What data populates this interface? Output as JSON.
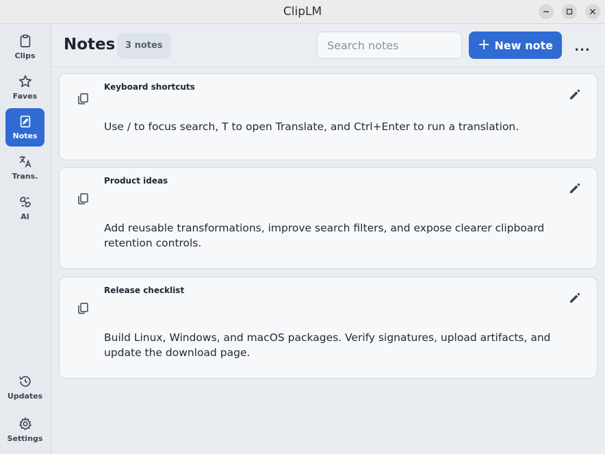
{
  "window": {
    "title": "ClipLM"
  },
  "sidebar": {
    "items": [
      {
        "label": "Clips",
        "icon": "clipboard-icon"
      },
      {
        "label": "Faves",
        "icon": "star-icon"
      },
      {
        "label": "Notes",
        "icon": "note-edit-icon",
        "active": true
      },
      {
        "label": "Trans.",
        "icon": "translate-icon"
      },
      {
        "label": "AI",
        "icon": "ai-icon"
      }
    ],
    "bottom": [
      {
        "label": "Updates",
        "icon": "history-icon"
      },
      {
        "label": "Settings",
        "icon": "gear-icon"
      }
    ]
  },
  "header": {
    "title": "Notes",
    "count": "3 notes",
    "search_placeholder": "Search notes",
    "new_button": "New note",
    "more": "..."
  },
  "notes": [
    {
      "title": "Keyboard shortcuts",
      "body": "Use / to focus search, T to open Translate, and Ctrl+Enter to run a translation."
    },
    {
      "title": "Product ideas",
      "body": "Add reusable transformations, improve search filters, and expose clearer clipboard retention controls."
    },
    {
      "title": "Release checklist",
      "body": "Build Linux, Windows, and macOS packages. Verify signatures, upload artifacts, and update the download page."
    }
  ],
  "colors": {
    "accent": "#2f6bd3",
    "background": "#e9edf2",
    "card": "#f6f8fa"
  }
}
